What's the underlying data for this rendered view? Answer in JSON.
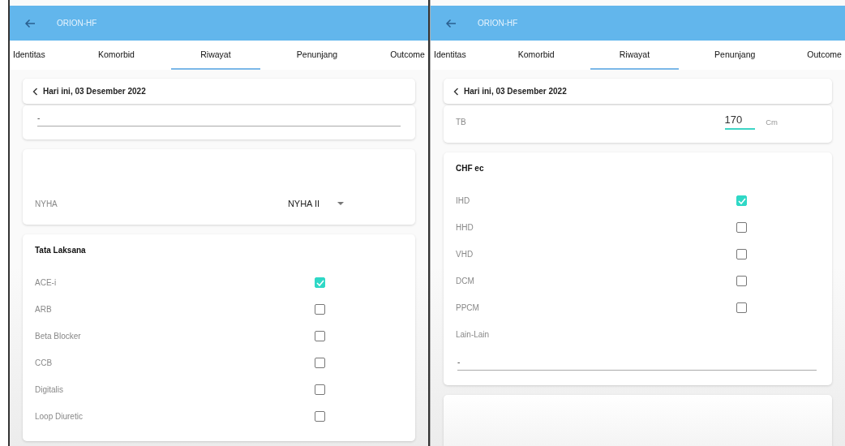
{
  "screens": [
    {
      "app_title": "ORION-HF",
      "tabs": [
        {
          "label": "Identitas",
          "selected": false
        },
        {
          "label": "Komorbid",
          "selected": false
        },
        {
          "label": "Riwayat",
          "selected": true
        },
        {
          "label": "Penunjang",
          "selected": false
        },
        {
          "label": "Outcome",
          "selected": false
        }
      ],
      "date": "Hari ini, 03 Desember 2022",
      "cards": [
        {
          "kind": "field",
          "value": "-"
        },
        {
          "kind": "select",
          "label": "NYHA",
          "value": "NYHA II"
        },
        {
          "kind": "checklist",
          "title": "Tata Laksana",
          "items": [
            {
              "label": "ACE-i",
              "checked": true
            },
            {
              "label": "ARB",
              "checked": false
            },
            {
              "label": "Beta Blocker",
              "checked": false
            },
            {
              "label": "CCB",
              "checked": false
            },
            {
              "label": "Digitalis",
              "checked": false
            },
            {
              "label": "Loop Diuretic",
              "checked": false
            }
          ]
        }
      ]
    },
    {
      "app_title": "ORION-HF",
      "tabs": [
        {
          "label": "Identitas",
          "selected": false
        },
        {
          "label": "Komorbid",
          "selected": false
        },
        {
          "label": "Riwayat",
          "selected": true
        },
        {
          "label": "Penunjang",
          "selected": false
        },
        {
          "label": "Outcome",
          "selected": false
        }
      ],
      "date": "Hari ini, 03 Desember 2022",
      "cards": [
        {
          "kind": "measure",
          "label": "TB",
          "value": "170",
          "unit": "Cm"
        },
        {
          "kind": "checklist",
          "title": "CHF ec",
          "items": [
            {
              "label": "IHD",
              "checked": true
            },
            {
              "label": "HHD",
              "checked": false
            },
            {
              "label": "VHD",
              "checked": false
            },
            {
              "label": "DCM",
              "checked": false
            },
            {
              "label": "PPCM",
              "checked": false
            }
          ],
          "other": {
            "label": "Lain-Lain",
            "value": "-"
          }
        },
        {
          "kind": "blank"
        }
      ]
    }
  ]
}
